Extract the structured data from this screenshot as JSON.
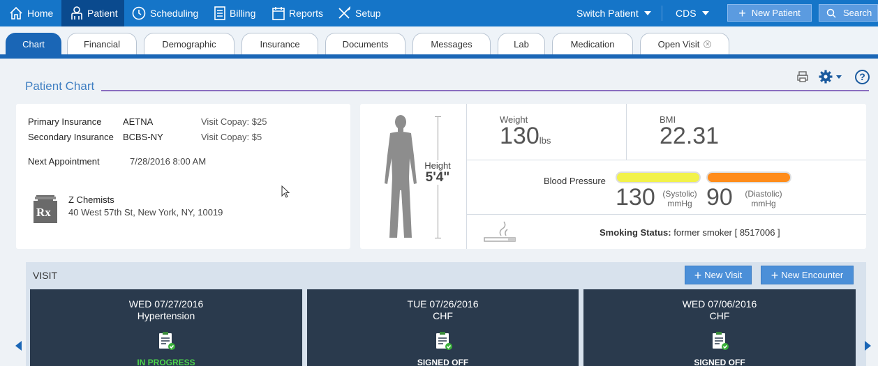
{
  "nav": {
    "items": [
      {
        "label": "Home",
        "icon": "home-icon"
      },
      {
        "label": "Patient",
        "icon": "patient-icon",
        "active": true
      },
      {
        "label": "Scheduling",
        "icon": "clock-icon"
      },
      {
        "label": "Billing",
        "icon": "billing-icon"
      },
      {
        "label": "Reports",
        "icon": "calendar-icon"
      },
      {
        "label": "Setup",
        "icon": "tools-icon"
      }
    ],
    "switch_patient": "Switch Patient",
    "cds": "CDS",
    "new_patient": "New Patient",
    "search": "Search"
  },
  "tabs": [
    {
      "label": "Chart",
      "active": true
    },
    {
      "label": "Financial"
    },
    {
      "label": "Demographic"
    },
    {
      "label": "Insurance"
    },
    {
      "label": "Documents"
    },
    {
      "label": "Messages"
    },
    {
      "label": "Lab"
    },
    {
      "label": "Medication"
    },
    {
      "label": "Open Visit",
      "closable": true
    }
  ],
  "page_title": "Patient Chart",
  "insurance": {
    "primary_label": "Primary Insurance",
    "primary_value": "AETNA",
    "primary_copay": "Visit Copay: $25",
    "secondary_label": "Secondary Insurance",
    "secondary_value": "BCBS-NY",
    "secondary_copay": "Visit Copay: $5",
    "next_appt_label": "Next Appointment",
    "next_appt_value": "7/28/2016 8:00 AM"
  },
  "pharmacy": {
    "name": "Z Chemists",
    "address": "40 West 57th St, New York, NY, 10019",
    "badge": "Rx"
  },
  "vitals": {
    "height_label": "Height",
    "height_value": "5'4\"",
    "weight_label": "Weight",
    "weight_value": "130",
    "weight_unit": "lbs",
    "bmi_label": "BMI",
    "bmi_value": "22.31",
    "bp_label": "Blood Pressure",
    "systolic": "130",
    "systolic_label": "(Systolic)",
    "systolic_unit": "mmHg",
    "diastolic": "90",
    "diastolic_label": "(Diastolic)",
    "diastolic_unit": "mmHg",
    "systolic_color": "#f2f24a",
    "diastolic_color": "#ff8c1a",
    "smoking_label": "Smoking Status:",
    "smoking_value": "former smoker [ 8517006 ]"
  },
  "visit": {
    "title": "VISIT",
    "new_visit": "New Visit",
    "new_encounter": "New Encounter",
    "cards": [
      {
        "date": "WED 07/27/2016",
        "title": "Hypertension",
        "status": "IN PROGRESS",
        "status_color": "#4cd44c"
      },
      {
        "date": "TUE 07/26/2016",
        "title": "CHF",
        "status": "SIGNED OFF",
        "status_color": "#ffffff"
      },
      {
        "date": "WED 07/06/2016",
        "title": "CHF",
        "status": "SIGNED OFF",
        "status_color": "#ffffff"
      }
    ]
  }
}
